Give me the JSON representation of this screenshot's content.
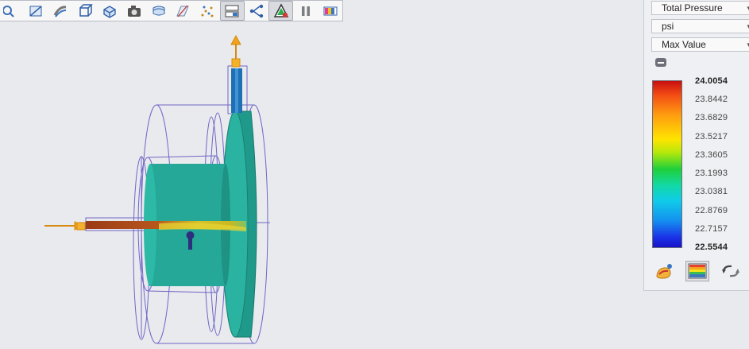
{
  "toolbar": {
    "buttons": [
      {
        "icon": "zoom-icon"
      },
      {
        "icon": "section-plane-icon"
      },
      {
        "icon": "streamline-icon"
      },
      {
        "icon": "box-view-icon"
      },
      {
        "icon": "iso-view-icon"
      },
      {
        "icon": "camera-icon"
      },
      {
        "icon": "surface-icon"
      },
      {
        "icon": "plane-clip-icon"
      },
      {
        "icon": "particle-trace-icon"
      },
      {
        "icon": "plot-settings-icon",
        "active": true
      },
      {
        "icon": "flow-path-icon"
      },
      {
        "icon": "triangle-results-icon",
        "active": true
      },
      {
        "icon": "pause-icon"
      },
      {
        "icon": "color-legend-icon"
      }
    ]
  },
  "results_panel": {
    "quantity": "Total Pressure",
    "unit": "psi",
    "range_mode": "Max Value",
    "legend_ticks": [
      "24.0054",
      "23.8442",
      "23.6829",
      "23.5217",
      "23.3605",
      "23.1993",
      "23.0381",
      "22.8769",
      "22.7157",
      "22.5544"
    ],
    "bottom_buttons": [
      {
        "icon": "results-display-icon"
      },
      {
        "icon": "shaded-contour-icon",
        "active": true
      },
      {
        "icon": "swap-arrows-icon"
      }
    ]
  },
  "colors": {
    "model_body": "#26a898",
    "wireframe": "#5a4fc0",
    "flow_arrow": "#f0a21c",
    "outlet_pipe": "#1f6fb4"
  }
}
